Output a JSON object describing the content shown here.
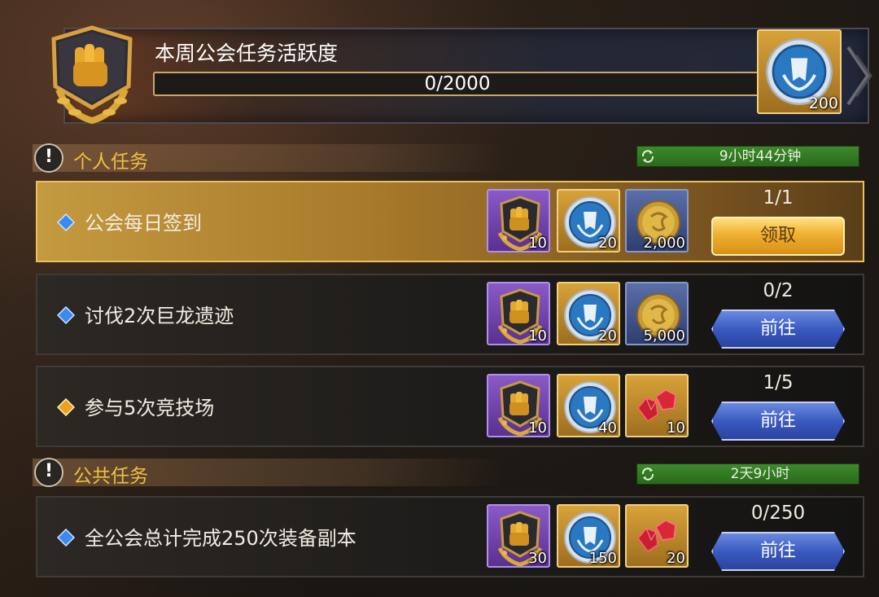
{
  "header": {
    "title": "本周公会任务活跃度",
    "progress_text": "0/2000",
    "progress_fraction": 0,
    "reward_count": "200",
    "reward_icon": "guild-coin-icon",
    "emblem_icon": "fist-emblem-icon"
  },
  "personal": {
    "title": "个人任务",
    "timer": "9小时44分钟",
    "tasks": [
      {
        "name": "公会每日签到",
        "progress": "1/1",
        "button": "领取",
        "rewards": [
          {
            "icon": "fist-emblem-icon",
            "count": "10"
          },
          {
            "icon": "guild-coin-icon",
            "count": "20"
          },
          {
            "icon": "gold-coin-icon",
            "count": "2,000"
          }
        ]
      },
      {
        "name": "讨伐2次巨龙遗迹",
        "progress": "0/2",
        "button": "前往",
        "rewards": [
          {
            "icon": "fist-emblem-icon",
            "count": "10"
          },
          {
            "icon": "guild-coin-icon",
            "count": "20"
          },
          {
            "icon": "gold-coin-icon",
            "count": "5,000"
          }
        ]
      },
      {
        "name": "参与5次竞技场",
        "progress": "1/5",
        "button": "前往",
        "rewards": [
          {
            "icon": "fist-emblem-icon",
            "count": "10"
          },
          {
            "icon": "guild-coin-icon",
            "count": "40"
          },
          {
            "icon": "ruby-icon",
            "count": "10"
          }
        ]
      }
    ]
  },
  "public": {
    "title": "公共任务",
    "timer": "2天9小时",
    "tasks": [
      {
        "name": "全公会总计完成250次装备副本",
        "progress": "0/250",
        "button": "前往",
        "rewards": [
          {
            "icon": "fist-emblem-icon",
            "count": "30"
          },
          {
            "icon": "guild-coin-icon",
            "count": "150"
          },
          {
            "icon": "ruby-icon",
            "count": "20"
          }
        ]
      }
    ]
  },
  "colors": {
    "accent_gold": "#f0c040",
    "timer_green": "#3c8a2a",
    "go_button_blue": "#3a5ac0",
    "claim_button_gold": "#f0b030"
  }
}
